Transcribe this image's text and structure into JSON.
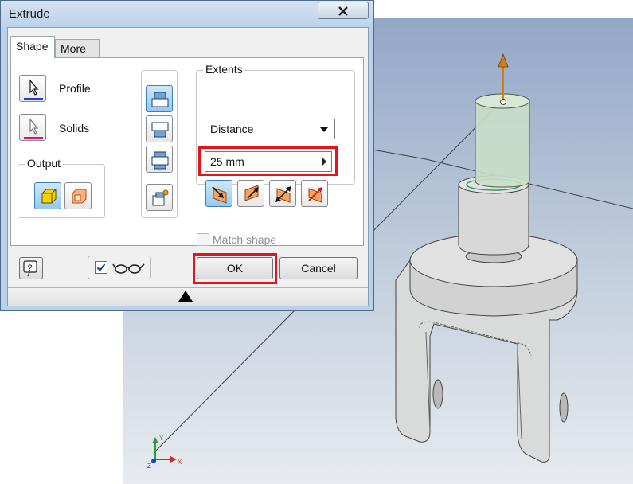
{
  "dialog": {
    "title": "Extrude",
    "tabs": [
      {
        "label": "Shape"
      },
      {
        "label": "More"
      }
    ],
    "profile_label": "Profile",
    "solids_label": "Solids",
    "output_group_title": "Output",
    "extents": {
      "group_title": "Extents",
      "type_selected": "Distance",
      "distance_value": "25 mm"
    },
    "match_shape_label": "Match shape",
    "ok_label": "OK",
    "cancel_label": "Cancel"
  },
  "colors": {
    "highlight_box": "#e3141b",
    "profile_underline": "#1f3fe0",
    "solids_underline": "#d4157a",
    "active_button": "#95c9ef",
    "preview_body": "#c9dfc8",
    "axis_arrow": "#d27d10"
  },
  "icons": {
    "close": "close-icon",
    "profile": "cursor-arrow-icon",
    "solids": "cursor-arrow-icon",
    "output_solid": "solid-cube-icon",
    "output_surface": "surface-cube-icon",
    "help": "help-icon",
    "preview": "glasses-icon"
  }
}
